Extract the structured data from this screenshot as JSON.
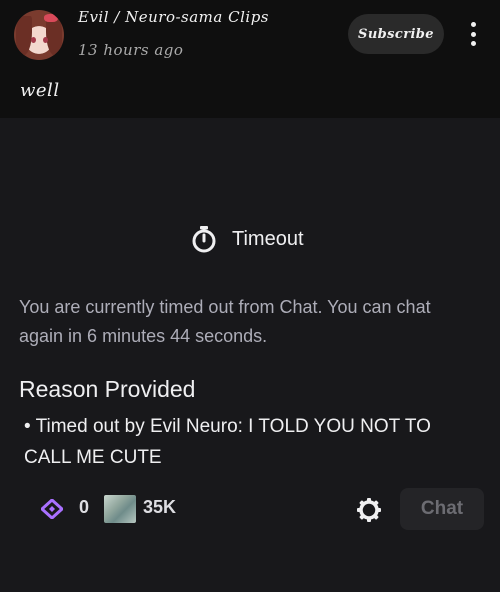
{
  "post": {
    "channel_name": "Evil / Neuro-sama Clips",
    "time_ago": "13 hours ago",
    "subscribe_label": "Subscribe",
    "text": "well"
  },
  "screenshot": {
    "timeout_title": "Timeout",
    "timeout_icon": "stopwatch-icon",
    "message": "You are currently timed out from Chat. You can chat again in 6 minutes 44 seconds.",
    "reason_heading": "Reason Provided",
    "reason_text": "• Timed out by Evil Neuro: I TOLD YOU NOT TO CALL ME CUTE",
    "chat_bar": {
      "points_icon": "channel-points-icon",
      "points_count": "0",
      "viewer_count": "35K",
      "settings_icon": "gear-icon",
      "chat_button_label": "Chat"
    }
  },
  "colors": {
    "background": "#0f0f0f",
    "panel": "#18181b",
    "points_accent": "#a970ff"
  }
}
